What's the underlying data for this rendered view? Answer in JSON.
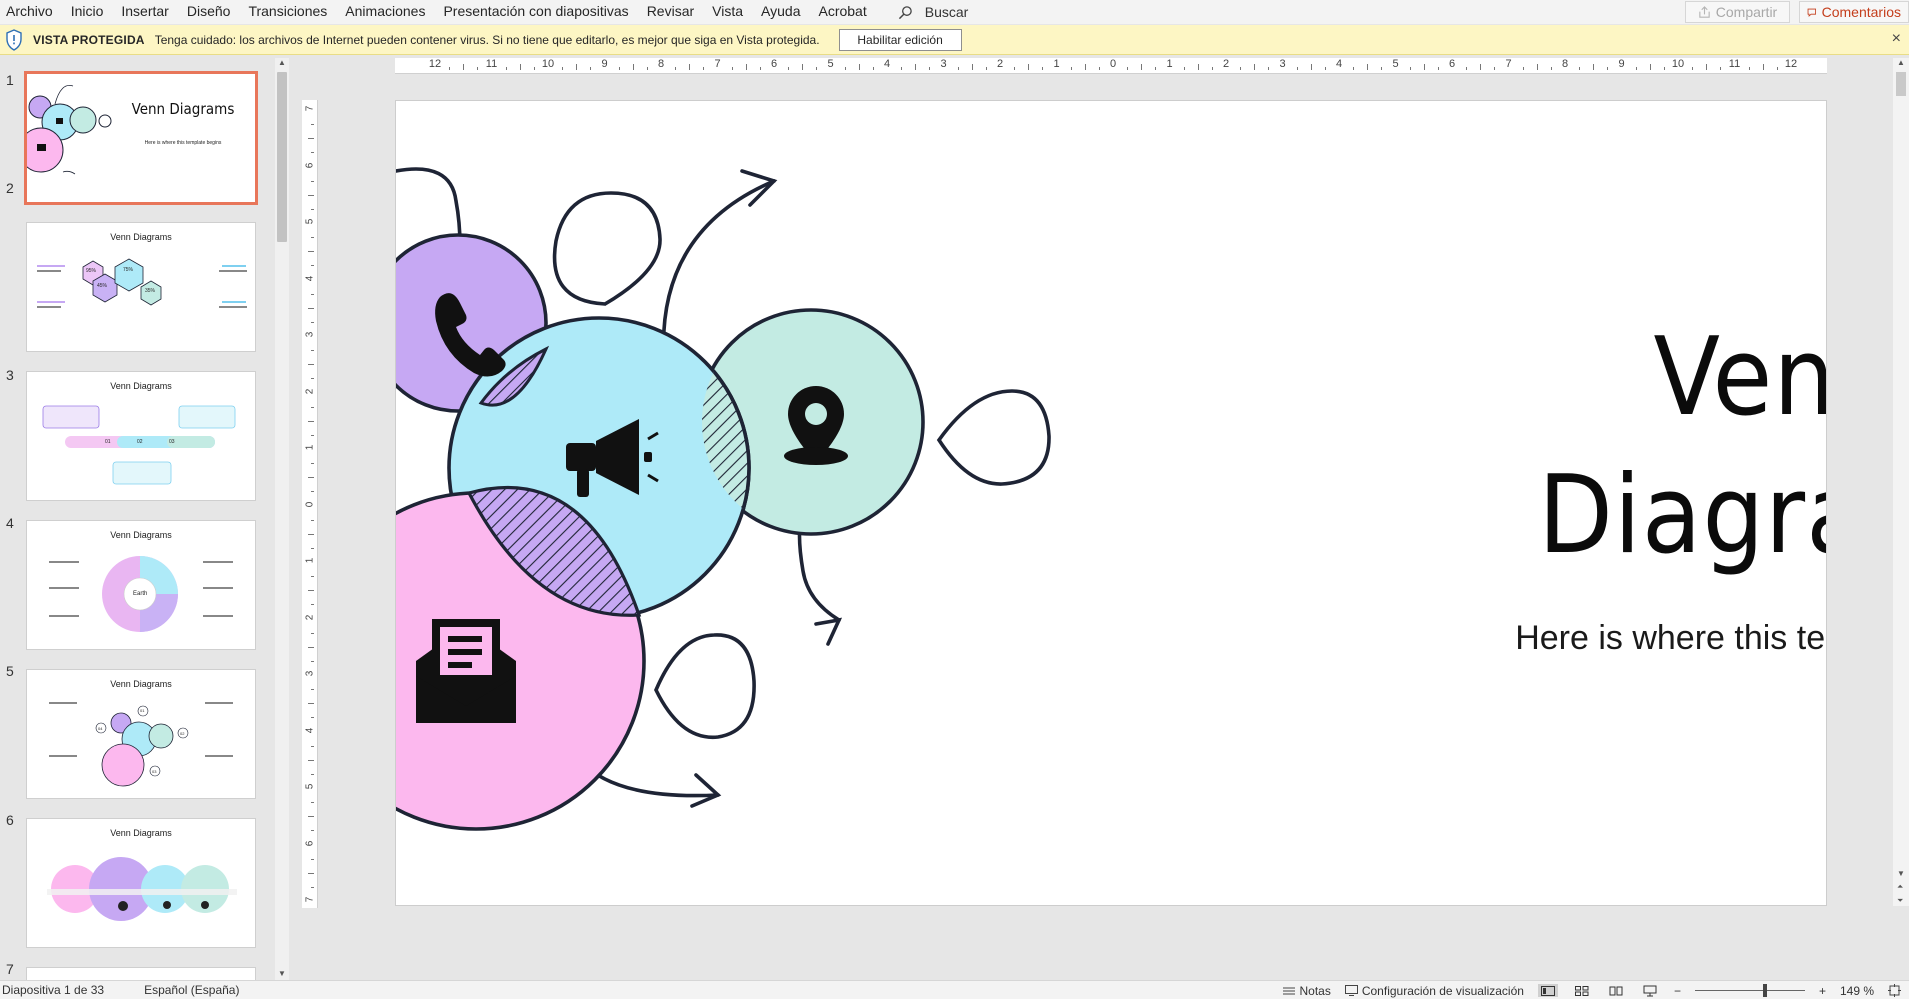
{
  "menu": {
    "tabs": [
      "Archivo",
      "Inicio",
      "Insertar",
      "Diseño",
      "Transiciones",
      "Animaciones",
      "Presentación con diapositivas",
      "Revisar",
      "Vista",
      "Ayuda",
      "Acrobat"
    ],
    "search_label": "Buscar",
    "share_label": "Compartir",
    "comments_label": "Comentarios"
  },
  "protected_view": {
    "title": "VISTA PROTEGIDA",
    "message": "Tenga cuidado: los archivos de Internet pueden contener virus. Si no tiene que editarlo, es mejor que siga en Vista protegida.",
    "enable_button": "Habilitar edición",
    "close_glyph": "×"
  },
  "thumbnails": [
    {
      "number": "1",
      "title": "Venn Diagrams",
      "subtitle": "Here is where this template begins"
    },
    {
      "number": "2",
      "title": "Venn Diagrams",
      "labels": [
        "95%",
        "75%",
        "45%",
        "35%"
      ]
    },
    {
      "number": "3",
      "title": "Venn Diagrams",
      "labels": [
        "01",
        "02",
        "03"
      ]
    },
    {
      "number": "4",
      "title": "Venn Diagrams",
      "labels": [
        "Earth"
      ]
    },
    {
      "number": "5",
      "title": "Venn Diagrams",
      "labels": [
        "01",
        "02",
        "03",
        "04"
      ]
    },
    {
      "number": "6",
      "title": "Venn Diagrams",
      "labels": []
    },
    {
      "number": "7"
    }
  ],
  "ruler": {
    "horizontal": [
      "12",
      "11",
      "10",
      "9",
      "8",
      "7",
      "6",
      "5",
      "4",
      "3",
      "2",
      "1",
      "0",
      "1",
      "2",
      "3",
      "4",
      "5",
      "6",
      "7",
      "8",
      "9",
      "10",
      "11",
      "12"
    ],
    "vertical": [
      "7",
      "6",
      "5",
      "4",
      "3",
      "2",
      "1",
      "0",
      "1",
      "2",
      "3",
      "4",
      "5",
      "6",
      "7"
    ]
  },
  "slide": {
    "title_line1": "Venn",
    "title_line2": "Diagrams",
    "subtitle": "Here is where this template begins",
    "colors": {
      "purple": "#c6a8f3",
      "blue": "#aeeaf8",
      "teal": "#c3ebe3",
      "pink": "#fcb8ee",
      "ink": "#1e2435"
    }
  },
  "status": {
    "slide_info": "Diapositiva 1 de 33",
    "language": "Español (España)",
    "notes_label": "Notas",
    "view_settings_label": "Configuración de visualización",
    "zoom_minus": "−",
    "zoom_plus": "+",
    "zoom_level": "149 %"
  }
}
